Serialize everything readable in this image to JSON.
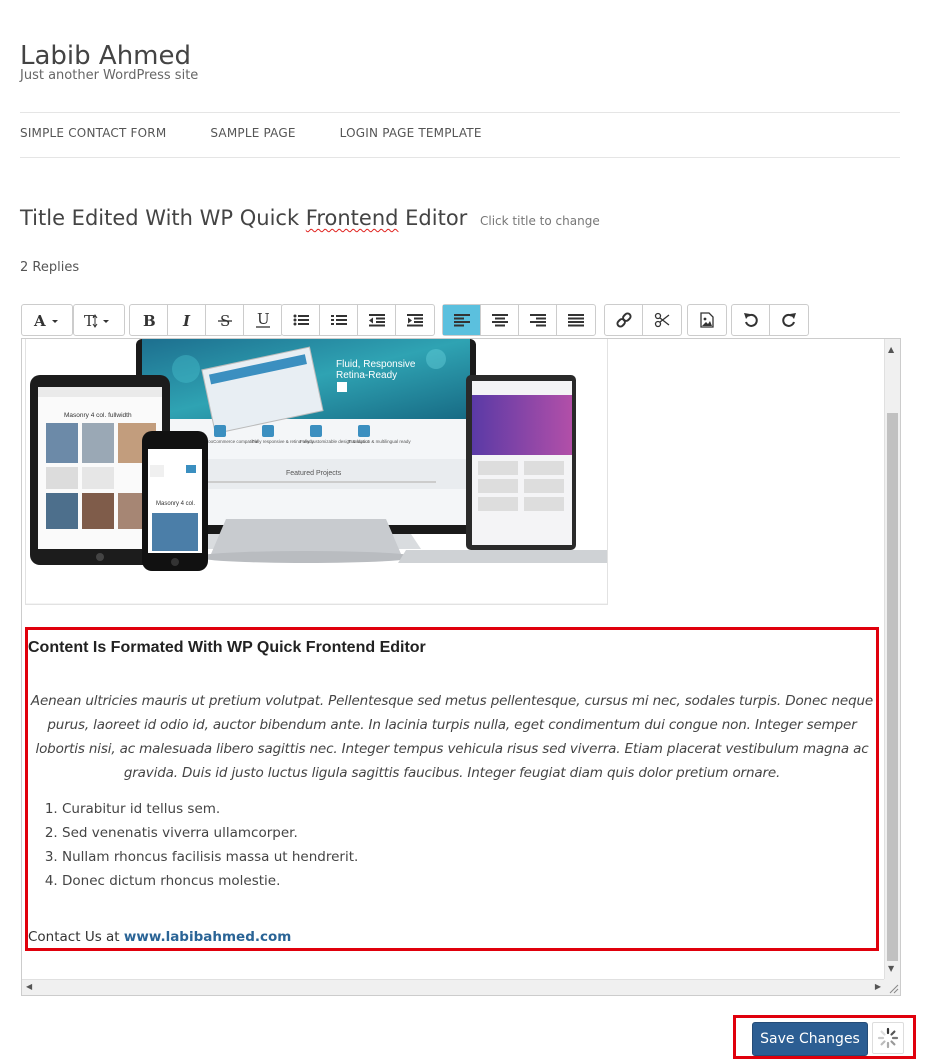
{
  "site": {
    "title": "Labib Ahmed",
    "tagline": "Just another WordPress site"
  },
  "nav": {
    "items": [
      {
        "label": "SIMPLE CONTACT FORM"
      },
      {
        "label": "SAMPLE PAGE"
      },
      {
        "label": "LOGIN PAGE TEMPLATE"
      }
    ]
  },
  "post": {
    "title_prefix": "Title Edited With WP Quick ",
    "title_spell": "Frontend",
    "title_suffix": " Editor",
    "title_hint": "Click title to change",
    "replies": "2 Replies"
  },
  "toolbar": {
    "icons": [
      "font-color-icon",
      "font-size-icon",
      "bold-icon",
      "italic-icon",
      "strikethrough-icon",
      "underline-icon",
      "unordered-list-icon",
      "ordered-list-icon",
      "outdent-icon",
      "indent-icon",
      "align-left-icon",
      "align-center-icon",
      "align-right-icon",
      "align-justify-icon",
      "link-icon",
      "unlink-icon",
      "insert-image-icon",
      "undo-icon",
      "redo-icon"
    ],
    "active": "align-left-icon",
    "accent": "#5bc0de"
  },
  "hero_image": {
    "texts": {
      "banner_title": "Fluid, Responsive",
      "banner_sub": "Retina-Ready",
      "tablet_title": "Masonry 4 col. fullwidth",
      "phone_title": "Masonry 4 col.",
      "featured": "Featured Projects",
      "feat1": "WooCommerce compatible",
      "feat2": "Fully responsive & retina ready",
      "feat3": "Fully customizable design & layout",
      "feat4": "Translation & multilingual ready"
    }
  },
  "content": {
    "heading": "Content Is Formated With WP Quick Frontend Editor",
    "paragraph": "Aenean ultricies mauris ut pretium volutpat. Pellentesque sed metus pellentesque, cursus mi nec, sodales turpis. Donec neque purus, laoreet id odio id, auctor bibendum ante. In lacinia turpis nulla, eget condimentum dui congue non. Integer semper lobortis nisi, ac malesuada libero sagittis nec. Integer tempus vehicula risus sed viverra. Etiam placerat vestibulum magna ac gravida. Duis id justo luctus ligula sagittis faucibus. Integer feugiat diam quis dolor pretium ornare.",
    "list": [
      "Curabitur id tellus sem.",
      " Sed venenatis viverra ullamcorper.",
      "Nullam rhoncus facilisis massa ut hendrerit.",
      "Donec dictum rhoncus molestie."
    ],
    "contact_prefix": "Contact Us at ",
    "contact_link": "www.labibahmed.com"
  },
  "actions": {
    "save_label": "Save Changes",
    "save_color": "#2c5e93",
    "highlight_color": "#e0000c"
  }
}
